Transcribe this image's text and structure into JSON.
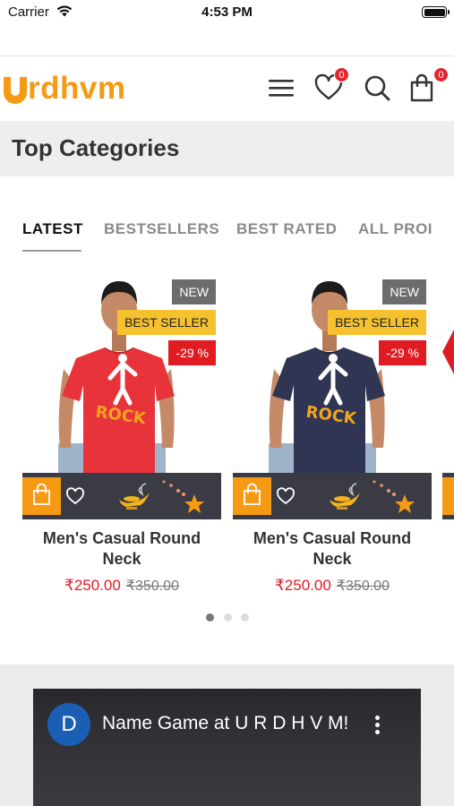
{
  "status_bar": {
    "carrier": "Carrier",
    "time": "4:53 PM",
    "battery_level": 1.0
  },
  "header": {
    "logo_text": "rdhvm",
    "brand_color": "#f59a12",
    "icons": [
      "menu-icon",
      "heart-icon",
      "search-icon",
      "cart-icon"
    ],
    "wishlist_count": "0",
    "cart_count": "0"
  },
  "section": {
    "title": "Top Categories"
  },
  "tabs": [
    {
      "label": "LATEST",
      "active": true
    },
    {
      "label": "BESTSELLERS",
      "active": false
    },
    {
      "label": "BEST RATED",
      "active": false
    },
    {
      "label": "ALL PROI",
      "active": false
    }
  ],
  "products": [
    {
      "tag_new": "NEW",
      "tag_best": "BEST SELLER",
      "tag_discount": "-29 %",
      "shirt_color": "#e8333a",
      "print_text": "ROCK",
      "name": "Men's Casual Round Neck",
      "price": "₹250.00",
      "old_price": "₹350.00"
    },
    {
      "tag_new": "NEW",
      "tag_best": "BEST SELLER",
      "tag_discount": "-29 %",
      "shirt_color": "#2f3552",
      "print_text": "ROCK",
      "name": "Men's Casual Round Neck",
      "price": "₹250.00",
      "old_price": "₹350.00"
    }
  ],
  "carousel": {
    "page_count": 3,
    "active_index": 0
  },
  "video": {
    "channel_initial": "D",
    "title": "Name Game at U R D H V M!"
  },
  "colors": {
    "accent": "#f59a12",
    "sale_red": "#e01b22",
    "badge_red": "#e3262e",
    "action_bar": "#3b3b45"
  }
}
